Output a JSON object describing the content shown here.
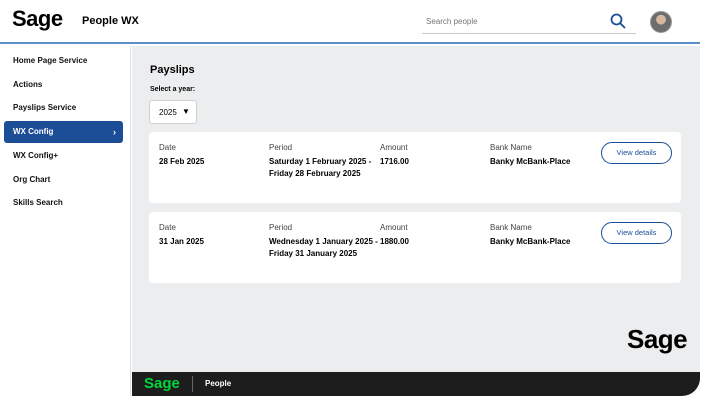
{
  "header": {
    "logo": "Sage",
    "app_name": "People WX",
    "search_placeholder": "Search people",
    "colors": {
      "accent_line": "#5b8fc7"
    }
  },
  "sidebar": {
    "items": [
      {
        "label": "Home Page Service",
        "active": false
      },
      {
        "label": "Actions",
        "active": false
      },
      {
        "label": "Payslips Service",
        "active": false
      },
      {
        "label": "WX Config",
        "active": true
      },
      {
        "label": "WX Config+",
        "active": false
      },
      {
        "label": "Org Chart",
        "active": false
      },
      {
        "label": "Skills Search",
        "active": false
      }
    ],
    "active_color": "#1b4e96"
  },
  "main": {
    "title": "Payslips",
    "year_label": "Select a year:",
    "year_value": "2025",
    "payslips": [
      {
        "date_label": "Date",
        "date": "28 Feb 2025",
        "period_label": "Period",
        "period": "Saturday 1 February 2025 - Friday 28 February 2025",
        "amount_label": "Amount",
        "amount": "1716.00",
        "bank_label": "Bank Name",
        "bank": "Banky McBank-Place",
        "button": "View details"
      },
      {
        "date_label": "Date",
        "date": "31 Jan 2025",
        "period_label": "Period",
        "period": "Wednesday 1 January 2025 - Friday 31 January 2025",
        "amount_label": "Amount",
        "amount": "1880.00",
        "bank_label": "Bank Name",
        "bank": "Banky McBank-Place",
        "button": "View details"
      }
    ],
    "watermark_logo": "Sage"
  },
  "footer": {
    "logo": "Sage",
    "name": "People",
    "logo_color": "#00d639"
  }
}
